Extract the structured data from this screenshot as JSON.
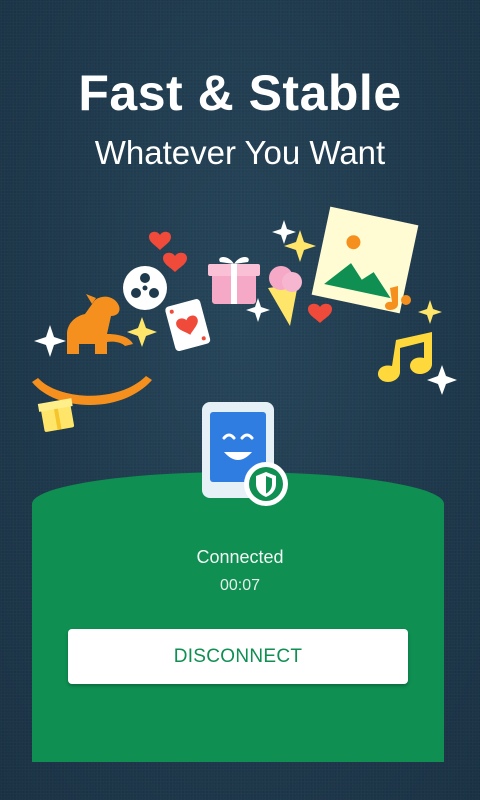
{
  "header": {
    "title": "Fast & Stable",
    "subtitle": "Whatever You Want"
  },
  "connection": {
    "status": "Connected",
    "timer": "00:07",
    "button_label": "DISCONNECT"
  },
  "colors": {
    "background": "#1f3a4d",
    "panel": "#0f8f52",
    "button_text": "#0f8f52",
    "accent_yellow": "#ffd93b",
    "accent_orange": "#f5901e",
    "heart_red": "#ef4a3a",
    "device_blue": "#2f7de1"
  },
  "icons": [
    "rocking-horse-icon",
    "film-reel-icon",
    "playing-card-icon",
    "gift-icon",
    "ice-cream-icon",
    "picture-icon",
    "music-note-icon",
    "heart-icon",
    "sparkle-icon",
    "small-gift-icon",
    "phone-icon",
    "shield-icon"
  ]
}
